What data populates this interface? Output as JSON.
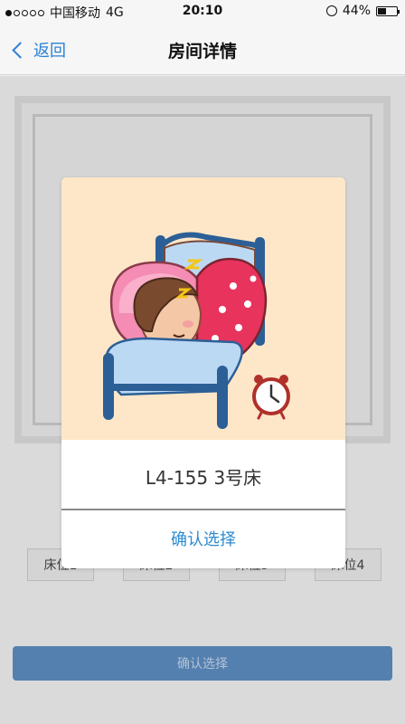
{
  "statusbar": {
    "carrier": "中国移动",
    "network": "4G",
    "time": "20:10",
    "battery_text": "44%",
    "battery_level": 0.44,
    "signal_filled": 1,
    "signal_total": 5
  },
  "navbar": {
    "back_label": "返回",
    "title": "房间详情"
  },
  "beds": [
    "床位1",
    "床位2",
    "床位3",
    "床位4"
  ],
  "bottom_button": "确认选择",
  "modal": {
    "bed_name": "L4-155 3号床",
    "confirm_label": "确认选择"
  },
  "colors": {
    "accent": "#2b82d4",
    "illustration_bg": "#fde7c8",
    "blanket": "#e8335d",
    "bed_frame": "#2c5f96"
  }
}
